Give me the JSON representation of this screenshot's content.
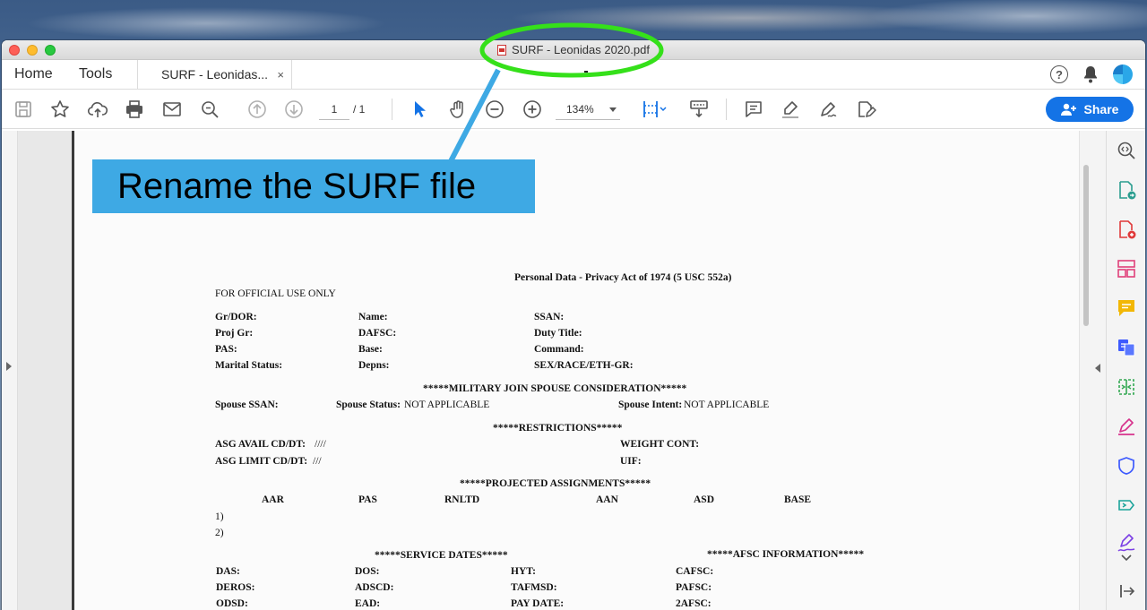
{
  "window": {
    "title": "SURF - Leonidas 2020.pdf"
  },
  "tabs": {
    "home": "Home",
    "tools": "Tools",
    "document": "SURF - Leonidas...",
    "close_glyph": "×"
  },
  "header_right": {
    "help_glyph": "?"
  },
  "toolbar": {
    "page_current": "1",
    "page_total": "/ 1",
    "zoom": "134%",
    "share_label": "Share"
  },
  "annotation": {
    "callout_text": "Rename the SURF file",
    "highlight_color": "#35e01a",
    "callout_color": "#3ea9e4"
  },
  "document": {
    "header": "Personal Data - Privacy Act of 1974 (5 USC 552a)",
    "fouo": "FOR OFFICIAL USE ONLY",
    "fields_row1": [
      "Gr/DOR:",
      "Name:",
      "SSAN:"
    ],
    "fields_row2": [
      "Proj Gr:",
      "DAFSC:",
      "Duty Title:"
    ],
    "fields_row3": [
      "PAS:",
      "Base:",
      "Command:"
    ],
    "fields_row4": [
      "Marital Status:",
      "Depns:",
      "SEX/RACE/ETH-GR:"
    ],
    "joint_spouse_heading": "*****MILITARY JOIN SPOUSE CONSIDERATION*****",
    "spouse_ssan": "Spouse SSAN:",
    "spouse_status_label": "Spouse Status:",
    "spouse_status_value": "NOT APPLICABLE",
    "spouse_intent_label": "Spouse Intent:",
    "spouse_intent_value": "NOT APPLICABLE",
    "restrictions_heading": "*****RESTRICTIONS*****",
    "asg_avail": "ASG AVAIL CD/DT:",
    "asg_avail_value": "////",
    "asg_limit": "ASG LIMIT CD/DT:",
    "asg_limit_value": "///",
    "weight_cont": "WEIGHT CONT:",
    "uif": "UIF:",
    "projected_heading": "*****PROJECTED ASSIGNMENTS*****",
    "projected_columns": [
      "AAR",
      "PAS",
      "RNLTD",
      "AAN",
      "ASD",
      "BASE"
    ],
    "projected_rows": [
      "1)",
      "2)"
    ],
    "service_dates_heading": "*****SERVICE DATES*****",
    "afsc_heading": "*****AFSC INFORMATION*****",
    "service_row1": [
      "DAS:",
      "DOS:",
      "HYT:",
      "CAFSC:"
    ],
    "service_row2": [
      "DEROS:",
      "ADSCD:",
      "TAFMSD:",
      "PAFSC:"
    ],
    "service_row3": [
      "ODSD:",
      "EAD:",
      "PAY DATE:",
      "2AFSC:"
    ]
  }
}
